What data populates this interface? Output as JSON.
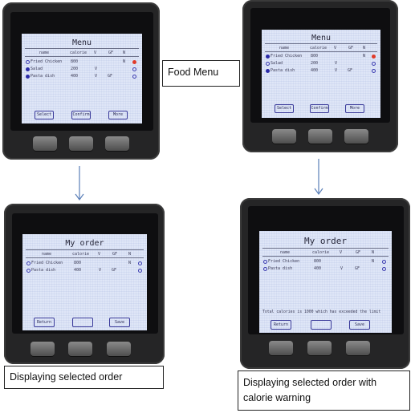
{
  "labels": {
    "food_menu": "Food Menu",
    "displaying_order": "Displaying selected order",
    "displaying_warning": "Displaying selected order with calorie warning"
  },
  "menu_screen": {
    "title": "Menu",
    "headers": [
      "name",
      "calorie",
      "V",
      "GF",
      "N"
    ],
    "rows": [
      {
        "name": "Fried Chicken",
        "calorie": "800",
        "v": "",
        "gf": "",
        "n": "N"
      },
      {
        "name": "Salad",
        "calorie": "200",
        "v": "V",
        "gf": "",
        "n": ""
      },
      {
        "name": "Pasta dish",
        "calorie": "400",
        "v": "V",
        "gf": "GF",
        "n": ""
      }
    ],
    "buttons": [
      "Select",
      "Confirm",
      "More"
    ]
  },
  "order_screen": {
    "title": "My order",
    "headers": [
      "name",
      "calorie",
      "V",
      "GF",
      "N"
    ],
    "rows": [
      {
        "name": "Fried Chicken",
        "calorie": "800",
        "v": "",
        "gf": "",
        "n": "N"
      },
      {
        "name": "Pasta dish",
        "calorie": "400",
        "v": "V",
        "gf": "GF",
        "n": ""
      }
    ],
    "buttons": [
      "Return",
      "",
      "Save"
    ]
  },
  "order_warning_screen": {
    "title": "My order",
    "headers": [
      "name",
      "calorie",
      "V",
      "GF",
      "N"
    ],
    "rows": [
      {
        "name": "Fried Chicken",
        "calorie": "800",
        "v": "",
        "gf": "",
        "n": "N"
      },
      {
        "name": "Pasta dish",
        "calorie": "400",
        "v": "V",
        "gf": "GF",
        "n": ""
      }
    ],
    "warning": "Total calories is 1000 which has exceeded the limit",
    "buttons": [
      "Return",
      "",
      "Save"
    ]
  },
  "colors": {
    "screen_bg": "#dfe6f7",
    "radio_selected": "#2a2aa8",
    "radio_active_red": "#e03a2a",
    "device_body": "#252526"
  },
  "icons": [
    "radio-selected-icon",
    "radio-unselected-icon",
    "arrow-down-icon"
  ]
}
